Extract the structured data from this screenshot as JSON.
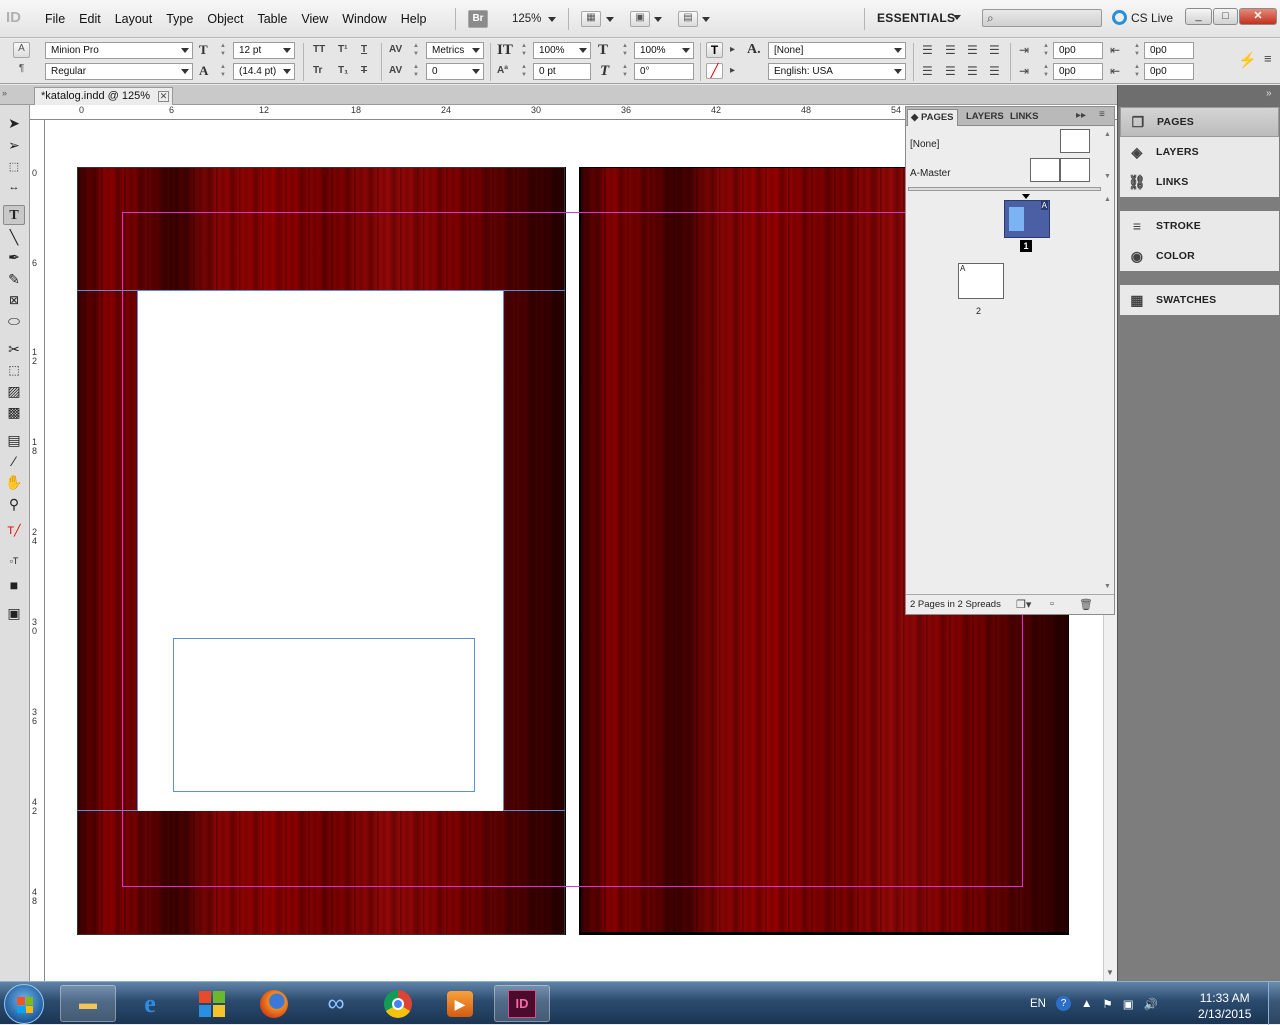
{
  "app": {
    "logo": "ID"
  },
  "menubar": {
    "items": [
      "File",
      "Edit",
      "Layout",
      "Type",
      "Object",
      "Table",
      "View",
      "Window",
      "Help"
    ],
    "bridge_label": "Br",
    "zoom": "125%",
    "workspace": "ESSENTIALS",
    "search_placeholder": "",
    "cslive": "CS Live",
    "win_buttons": [
      "_",
      "□",
      "✕"
    ]
  },
  "control": {
    "font_family": "Minion Pro",
    "font_style": "Regular",
    "font_size": "12 pt",
    "leading": "(14.4 pt)",
    "kerning": "Metrics",
    "tracking": "0",
    "vscale": "100%",
    "hscale": "100%",
    "baseline_shift": "0 pt",
    "skew": "0°",
    "char_style": "[None]",
    "language": "English: USA",
    "indent_left": "0p0",
    "indent_first": "0p0",
    "indent_right": "0p0",
    "indent_last": "0p0"
  },
  "document": {
    "tab_title": "*katalog.indd @ 125%",
    "ruler_top": [
      "0",
      "6",
      "12",
      "18",
      "24",
      "30",
      "36",
      "42",
      "48",
      "54"
    ],
    "ruler_left": [
      "0",
      "6",
      "1 2",
      "1 8",
      "2 4",
      "3 0",
      "3 6",
      "4 2",
      "4 8"
    ]
  },
  "pages_panel": {
    "tabs": [
      "PAGES",
      "LAYERS",
      "LINKS"
    ],
    "masters": [
      "[None]",
      "A-Master"
    ],
    "page1_label": "1",
    "page1_master": "A",
    "page2_label": "2",
    "page2_master": "A",
    "footer": "2 Pages in 2 Spreads"
  },
  "dock": {
    "group1": [
      "PAGES",
      "LAYERS",
      "LINKS"
    ],
    "group2": [
      "STROKE",
      "COLOR"
    ],
    "group3": [
      "SWATCHES"
    ]
  },
  "taskbar": {
    "language": "EN",
    "time": "11:33 AM",
    "date": "2/13/2015",
    "indesign_label": "ID"
  },
  "colors": {
    "accent_magenta": "#d436d4",
    "frame_blue": "#5b8fd6",
    "curtain_red": "#8c0000"
  }
}
